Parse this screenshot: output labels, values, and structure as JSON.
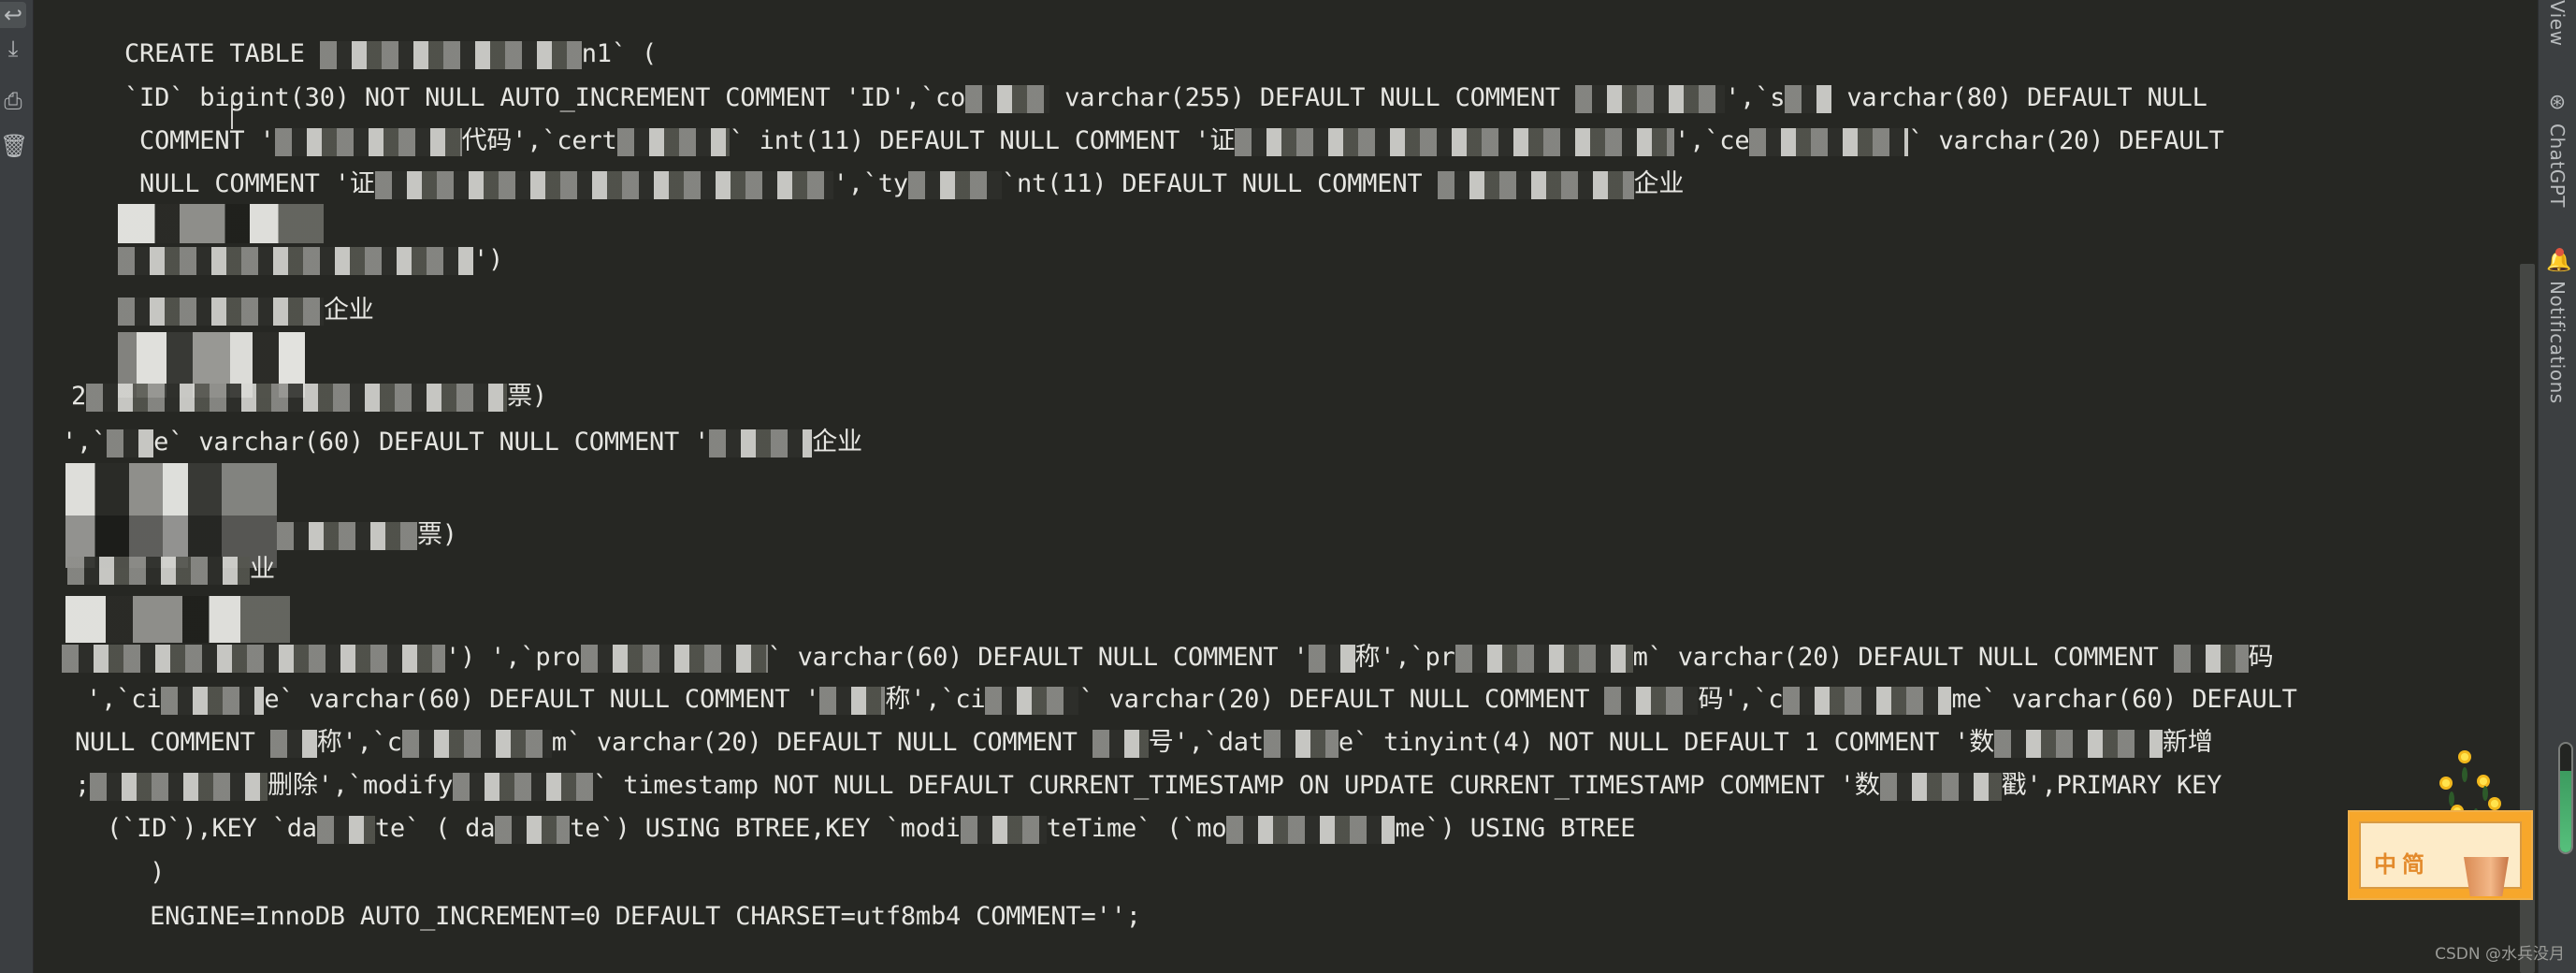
{
  "gutter": {
    "icons": [
      "soft-wrap-icon",
      "scroll-to-end-icon",
      "print-icon",
      "delete-icon"
    ]
  },
  "editor": {
    "lines": [
      {
        "pre": "CREATE TABLE ",
        "redact": true,
        "post": "n1` ("
      },
      {
        "pre": "`ID` bigint(30) NOT NULL AUTO_INCREMENT COMMENT 'ID',`co",
        "redact": true,
        "post": " varchar(255) DEFAULT NULL COMMENT ",
        "redact2": true,
        "post2": "',`s",
        "redact3": true,
        "post3": " varchar(80) DEFAULT NULL"
      },
      {
        "pre": " COMMENT '",
        "redact": true,
        "post": "代码',`cert",
        "redact2": true,
        "post2": "` int(11) DEFAULT NULL COMMENT '证",
        "redact3": true,
        "post3": "',`ce",
        "redact4": true,
        "post4": "` varchar(20) DEFAULT"
      },
      {
        "pre": " NULL COMMENT '证",
        "redact": true,
        "post": "',`ty",
        "redact2": true,
        "post2": "`nt(11) DEFAULT NULL COMMENT ",
        "redact3": true,
        "post3": "企业"
      },
      {
        "pre": "",
        "redact": true,
        "post": ""
      },
      {
        "pre": "",
        "redact": true,
        "post": "')"
      },
      {
        "pre": "",
        "redact": true,
        "post": "企业"
      },
      {
        "pre": "",
        "redact": true,
        "post": "\""
      },
      {
        "pre": "2",
        "redact": true,
        "post": "票)"
      },
      {
        "pre": "',`",
        "redact": true,
        "post": "e` varchar(60) DEFAULT NULL COMMENT '",
        "redact2": true,
        "post2": "企业"
      },
      {
        "pre": "",
        "redact": true,
        "post": ""
      },
      {
        "pre": "",
        "redact": true,
        "post": "票)"
      },
      {
        "pre": "",
        "redact": true,
        "post": "业"
      },
      {
        "pre": "",
        "redact": true,
        "post": ""
      },
      {
        "pre": "",
        "redact": true,
        "post": "') ',`pro",
        "redact2": true,
        "post2": "` varchar(60) DEFAULT NULL COMMENT '",
        "redact3": true,
        "post3": "称',`pr",
        "redact4": true,
        "post4": "m` varchar(20) DEFAULT NULL COMMENT ",
        "redact5": true,
        "post5": "码"
      },
      {
        "pre": " ',`ci",
        "redact": true,
        "post": "e` varchar(60) DEFAULT NULL COMMENT '",
        "redact2": true,
        "post2": "称',`ci",
        "redact3": true,
        "post3": "` varchar(20) DEFAULT NULL COMMENT ",
        "redact4": true,
        "post4": "码',`c",
        "redact5": true,
        "post5": "me` varchar(60) DEFAULT"
      },
      {
        "pre": "NULL COMMENT ",
        "redact": true,
        "post": "称',`c",
        "redact2": true,
        "post2": "m` varchar(20) DEFAULT NULL COMMENT ",
        "redact3": true,
        "post3": "号',`dat",
        "redact4": true,
        "post4": "e` tinyint(4) NOT NULL DEFAULT 1 COMMENT '数",
        "redact5": true,
        "post5": "新增"
      },
      {
        "pre": ";",
        "redact": true,
        "post": "删除',`modify",
        "redact2": true,
        "post2": "` timestamp NOT NULL DEFAULT CURRENT_TIMESTAMP ON UPDATE CURRENT_TIMESTAMP COMMENT '数",
        "redact3": true,
        "post3": "戳',PRIMARY KEY"
      },
      {
        "pre": " (`ID`),KEY `da",
        "redact": true,
        "post": "te` ( da",
        "redact2": true,
        "post2": "te`) USING BTREE,KEY `modi",
        "redact3": true,
        "post3": "teTime` (`mo",
        "redact4": true,
        "post4": "me`) USING BTREE"
      },
      {
        "pre": "  )",
        "redact": false,
        "post": ""
      },
      {
        "pre": "  ENGINE=InnoDB AUTO_INCREMENT=0 DEFAULT CHARSET=utf8mb4 COMMENT='';",
        "redact": false,
        "post": ""
      }
    ]
  },
  "right_toolbar": {
    "view_label": "View",
    "chatgpt_label": "ChatGPT",
    "notifications_label": "Notifications"
  },
  "memory_indicator": {
    "usage_fraction": 0.75
  },
  "sticker": {
    "text": "中简"
  },
  "watermark": "CSDN @水兵没月",
  "colors": {
    "editor_bg": "#262723",
    "gutter_bg": "#3b3e41",
    "text": "#e6e6e2",
    "notification_dot": "#e0553f",
    "memory_fill": "#56c07c"
  }
}
